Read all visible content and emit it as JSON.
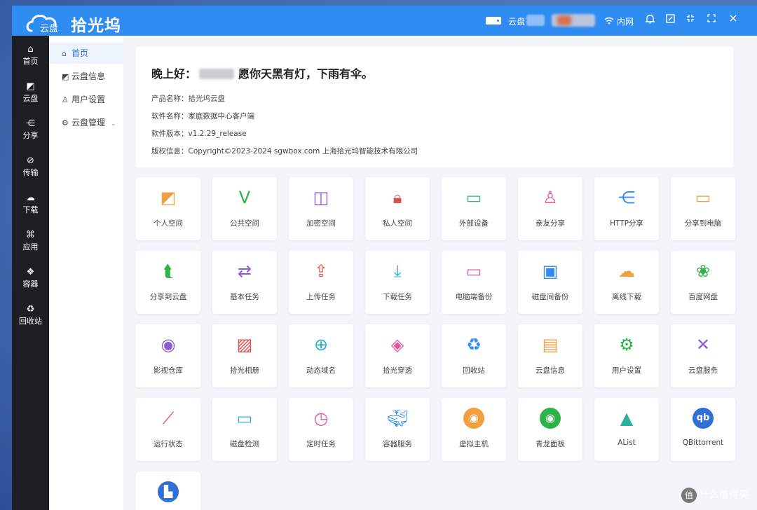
{
  "app": {
    "logo_text": "云盘",
    "title": "拾光坞"
  },
  "titlebar": {
    "cloud_label": "云盘",
    "network_label": "内网",
    "icons": [
      "hdd-icon",
      "wifi-icon",
      "bell-icon",
      "edit-icon",
      "minimize-icon",
      "maximize-icon",
      "close-icon"
    ]
  },
  "nav": [
    {
      "label": "首页",
      "icon": "home-icon"
    },
    {
      "label": "云盘",
      "icon": "cloud-disk-icon"
    },
    {
      "label": "分享",
      "icon": "share-icon"
    },
    {
      "label": "传输",
      "icon": "transfer-icon"
    },
    {
      "label": "下载",
      "icon": "download-icon"
    },
    {
      "label": "应用",
      "icon": "apps-icon"
    },
    {
      "label": "容器",
      "icon": "container-icon"
    },
    {
      "label": "回收站",
      "icon": "recycle-icon"
    }
  ],
  "subnav": [
    {
      "label": "首页",
      "icon": "home-icon"
    },
    {
      "label": "云盘信息",
      "icon": "info-icon"
    },
    {
      "label": "用户设置",
      "icon": "user-icon"
    },
    {
      "label": "云盘管理",
      "icon": "gear-icon"
    }
  ],
  "welcome": {
    "greeting_prefix": "晚上好：",
    "greeting_suffix": "愿你天黑有灯，下雨有伞。",
    "lines": [
      "产品名称：拾光坞云盘",
      "软件名称：家庭数据中心客户端",
      "软件版本：v1.2.29_release",
      "版权信息：Copyright©2023-2024 sgwbox.com 上海拾光坞智能技术有限公司"
    ]
  },
  "tiles": [
    {
      "label": "个人空间",
      "icon": "personal-space-icon",
      "glyph": "◩",
      "color": "#f0a040"
    },
    {
      "label": "公共空间",
      "icon": "public-space-icon",
      "glyph": "ⴸ",
      "color": "#2cb34a"
    },
    {
      "label": "加密空间",
      "icon": "encrypted-space-icon",
      "glyph": "◫",
      "color": "#8a5cd6"
    },
    {
      "label": "私人空间",
      "icon": "lock-icon",
      "glyph": "🔒︎",
      "color": "#e24d4d"
    },
    {
      "label": "外部设备",
      "icon": "usb-icon",
      "glyph": "▭",
      "color": "#35b86f"
    },
    {
      "label": "亲友分享",
      "icon": "user-share-icon",
      "glyph": "♙",
      "color": "#e3579a"
    },
    {
      "label": "HTTP分享",
      "icon": "share-nodes-icon",
      "glyph": "⋲",
      "color": "#2f8cf2"
    },
    {
      "label": "分享到电脑",
      "icon": "folder-share-icon",
      "glyph": "▭",
      "color": "#f0a040"
    },
    {
      "label": "分享到云盘",
      "icon": "share-to-cloud-icon",
      "glyph": "⮬",
      "color": "#2cb34a"
    },
    {
      "label": "基本任务",
      "icon": "task-icon",
      "glyph": "⇄",
      "color": "#8a5cd6"
    },
    {
      "label": "上传任务",
      "icon": "upload-icon",
      "glyph": "⇪",
      "color": "#e24d4d"
    },
    {
      "label": "下载任务",
      "icon": "download-task-icon",
      "glyph": "⤓",
      "color": "#2bb0c9"
    },
    {
      "label": "电脑端备份",
      "icon": "monitor-icon",
      "glyph": "▭",
      "color": "#e3579a"
    },
    {
      "label": "磁盘间备份",
      "icon": "disk-backup-icon",
      "glyph": "▣",
      "color": "#2f8cf2"
    },
    {
      "label": "离线下载",
      "icon": "cloud-download-icon",
      "glyph": "☁",
      "color": "#f0a040"
    },
    {
      "label": "百度网盘",
      "icon": "paw-icon",
      "glyph": "❀",
      "color": "#2cb34a"
    },
    {
      "label": "影视仓库",
      "icon": "film-reel-icon",
      "glyph": "◉",
      "color": "#8a5cd6"
    },
    {
      "label": "拾光相册",
      "icon": "photo-icon",
      "glyph": "▨",
      "color": "#e24d4d"
    },
    {
      "label": "动态域名",
      "icon": "globe-icon",
      "glyph": "⊕",
      "color": "#2bb0c9"
    },
    {
      "label": "拾光穿透",
      "icon": "layers-icon",
      "glyph": "◈",
      "color": "#e3579a"
    },
    {
      "label": "回收站",
      "icon": "recycle-icon",
      "glyph": "♻",
      "color": "#2f8cf2"
    },
    {
      "label": "云盘信息",
      "icon": "file-info-icon",
      "glyph": "▤",
      "color": "#f0a040"
    },
    {
      "label": "用户设置",
      "icon": "gear-icon",
      "glyph": "⚙",
      "color": "#2cb34a"
    },
    {
      "label": "云盘服务",
      "icon": "tools-icon",
      "glyph": "✕",
      "color": "#8a5cd6"
    },
    {
      "label": "运行状态",
      "icon": "chart-line-icon",
      "glyph": "⟋",
      "color": "#e24d4d"
    },
    {
      "label": "磁盘检测",
      "icon": "disk-check-icon",
      "glyph": "▭",
      "color": "#2bb0c9"
    },
    {
      "label": "定时任务",
      "icon": "timer-icon",
      "glyph": "◷",
      "color": "#e3579a"
    },
    {
      "label": "容器服务",
      "icon": "docker-icon",
      "glyph": "🐳︎",
      "color": "#2f8cf2"
    },
    {
      "label": "虚拟主机",
      "icon": "ubuntu-icon",
      "glyph": "◉",
      "color": "#f0a040"
    },
    {
      "label": "青龙面板",
      "icon": "qinglong-icon",
      "glyph": "◉",
      "color": "#2cb34a"
    },
    {
      "label": "AList",
      "icon": "alist-icon",
      "glyph": "▲",
      "color": "#2bb0a0"
    },
    {
      "label": "QBittorrent",
      "icon": "qbittorrent-icon",
      "glyph": "qb",
      "color": "#2f6fd6"
    },
    {
      "label": "",
      "icon": "app-icon",
      "glyph": "▙",
      "color": "#2f6fd6"
    }
  ],
  "watermark": {
    "badge": "值",
    "text": "什么值得买"
  }
}
